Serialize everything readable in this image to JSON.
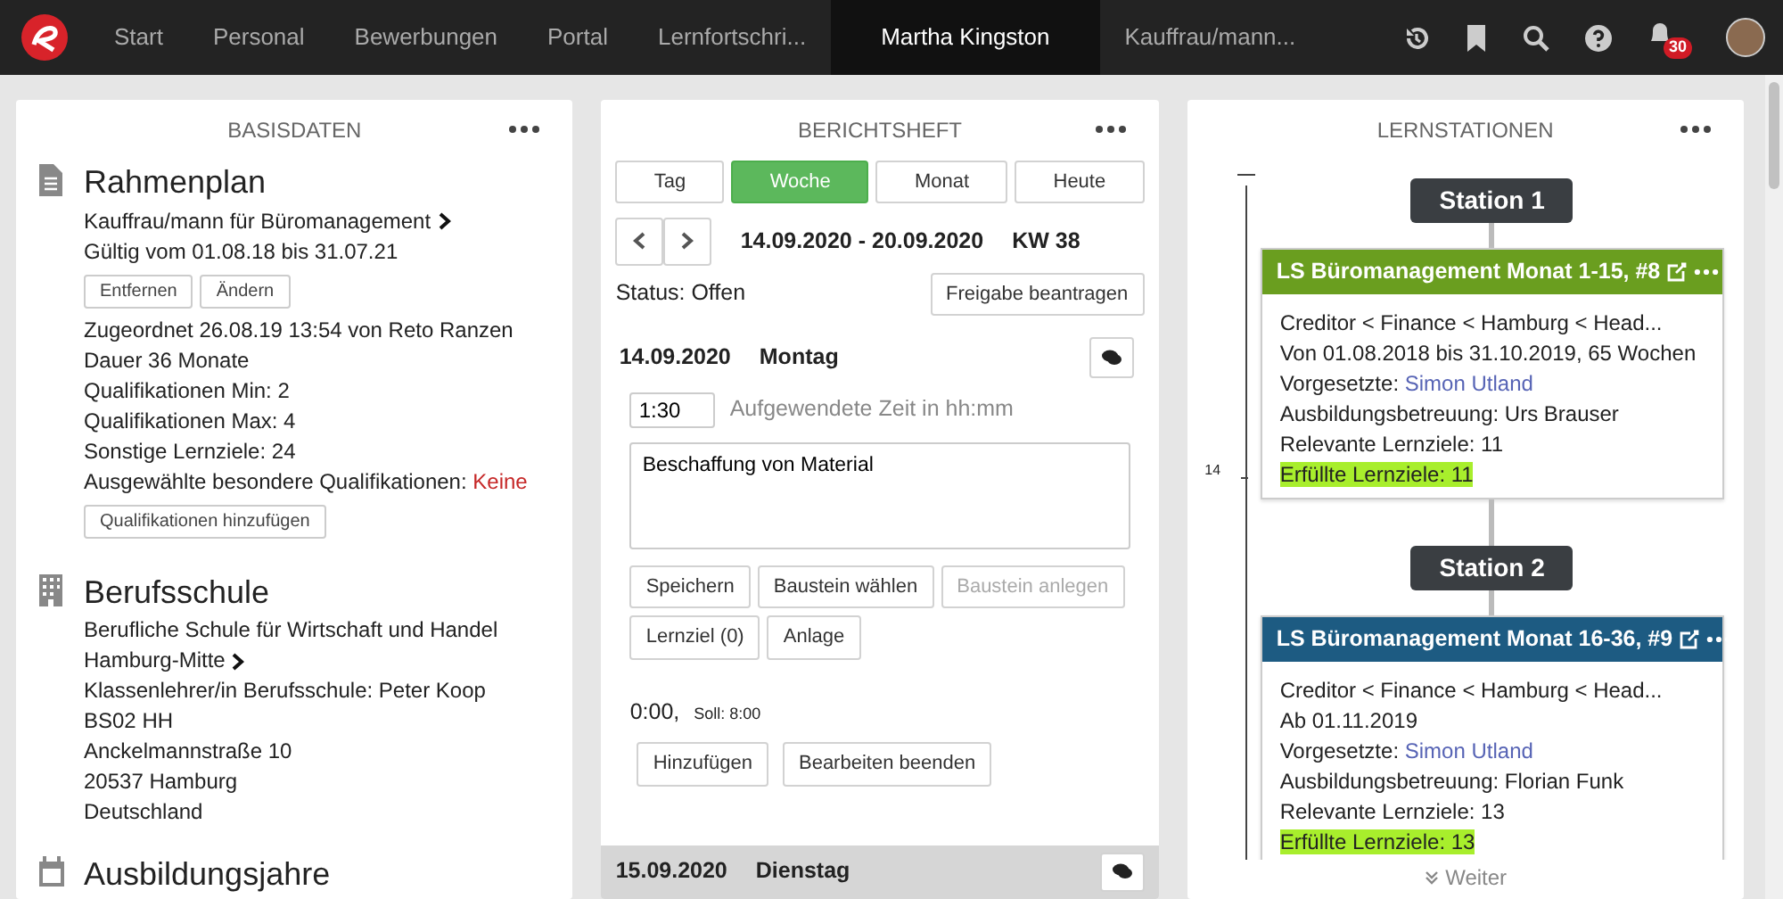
{
  "nav": {
    "items": [
      {
        "label": "Start",
        "selected": false
      },
      {
        "label": "Personal",
        "selected": false
      },
      {
        "label": "Bewerbungen",
        "selected": false
      },
      {
        "label": "Portal",
        "selected": false
      },
      {
        "label": "Lernfortschri...",
        "selected": false
      },
      {
        "label": "Martha Kingston",
        "selected": true
      },
      {
        "label": "Kauffrau/mann...",
        "selected": false
      }
    ],
    "notification_count": "30"
  },
  "basisdaten": {
    "title": "BASISDATEN",
    "sections": [
      {
        "heading": "Rahmenplan",
        "lines": [
          {
            "kind": "link",
            "text": "Kauffrau/mann für Büromanagement"
          },
          {
            "kind": "text",
            "text": "Gültig vom 01.08.18 bis 31.07.21"
          },
          {
            "kind": "buttons",
            "buttons": [
              "Entfernen",
              "Ändern"
            ]
          },
          {
            "kind": "text",
            "text": "Zugeordnet 26.08.19 13:54 von Reto Ranzen"
          },
          {
            "kind": "text",
            "text": "Dauer 36 Monate"
          },
          {
            "kind": "text",
            "text": "Qualifikationen Min: 2"
          },
          {
            "kind": "text",
            "text": "Qualifikationen Max: 4"
          },
          {
            "kind": "text",
            "text": "Sonstige Lernziele: 24"
          },
          {
            "kind": "value",
            "text": "Ausgewählte besondere Qualifikationen:",
            "value": "Keine"
          },
          {
            "kind": "buttons",
            "buttons": [
              "Qualifikationen hinzufügen"
            ]
          }
        ]
      },
      {
        "heading": "Berufsschule",
        "lines": [
          {
            "kind": "text",
            "text": "Berufliche Schule für Wirtschaft und Handel"
          },
          {
            "kind": "link",
            "text": "Hamburg-Mitte"
          },
          {
            "kind": "text",
            "text": "Klassenlehrer/in Berufsschule: Peter Koop"
          },
          {
            "kind": "text",
            "text": "BS02 HH"
          },
          {
            "kind": "text",
            "text": "Anckelmannstraße 10"
          },
          {
            "kind": "text",
            "text": "20537 Hamburg"
          },
          {
            "kind": "text",
            "text": "Deutschland"
          }
        ]
      },
      {
        "heading": "Ausbildungsjahre"
      }
    ]
  },
  "berichtsheft": {
    "title": "BERICHTSHEFT",
    "period_tabs": [
      {
        "label": "Tag",
        "selected": false
      },
      {
        "label": "Woche",
        "selected": true
      },
      {
        "label": "Monat",
        "selected": false
      },
      {
        "label": "Heute",
        "selected": false
      }
    ],
    "date_range": "14.09.2020 - 20.09.2020",
    "week": "KW 38",
    "status": "Status: Offen",
    "release_button": "Freigabe beantragen",
    "day": {
      "date": "14.09.2020",
      "weekday": "Montag"
    },
    "time_value": "1:30",
    "time_label": "Aufgewendete Zeit in hh:mm",
    "text_value": "Beschaffung von Material",
    "buttons": [
      {
        "label": "Speichern",
        "disabled": false
      },
      {
        "label": "Baustein wählen",
        "disabled": false
      },
      {
        "label": "Baustein anlegen",
        "disabled": true
      },
      {
        "label": "Lernziel (0)",
        "disabled": false
      },
      {
        "label": "Anlage",
        "disabled": false
      }
    ],
    "total": "0:00,",
    "target": "Soll: 8:00",
    "footer_buttons": [
      "Hinzufügen",
      "Bearbeiten beenden"
    ],
    "next_day": {
      "date": "15.09.2020",
      "weekday": "Dienstag"
    }
  },
  "lernstationen": {
    "title": "LERNSTATIONEN",
    "scale_label": "14",
    "stations": [
      {
        "label": "Station 1",
        "title": "LS Büromanagement Monat 1-15, #8",
        "color": "#6a9e1f",
        "lines": [
          {
            "kind": "text",
            "text": "Creditor < Finance < Hamburg < Head..."
          },
          {
            "kind": "text",
            "text": "Von 01.08.2018 bis 31.10.2019, 65 Wochen"
          },
          {
            "kind": "person",
            "text": "Vorgesetzte:",
            "value": "Simon Utland"
          },
          {
            "kind": "text",
            "text": "Ausbildungsbetreuung: Urs Brauser"
          },
          {
            "kind": "text",
            "text": "Relevante Lernziele: 11"
          },
          {
            "kind": "highlight",
            "text": "Erfüllte Lernziele: 11"
          }
        ]
      },
      {
        "label": "Station 2",
        "title": "LS Büromanagement Monat 16-36, #9",
        "color": "#1d5b82",
        "lines": [
          {
            "kind": "text",
            "text": "Creditor < Finance < Hamburg < Head..."
          },
          {
            "kind": "text",
            "text": "Ab 01.11.2019"
          },
          {
            "kind": "person",
            "text": "Vorgesetzte:",
            "value": "Simon Utland"
          },
          {
            "kind": "text",
            "text": "Ausbildungsbetreuung: Florian Funk"
          },
          {
            "kind": "text",
            "text": "Relevante Lernziele: 13"
          },
          {
            "kind": "highlight",
            "text": "Erfüllte Lernziele: 13"
          }
        ]
      }
    ],
    "more_link": "Weiter"
  }
}
